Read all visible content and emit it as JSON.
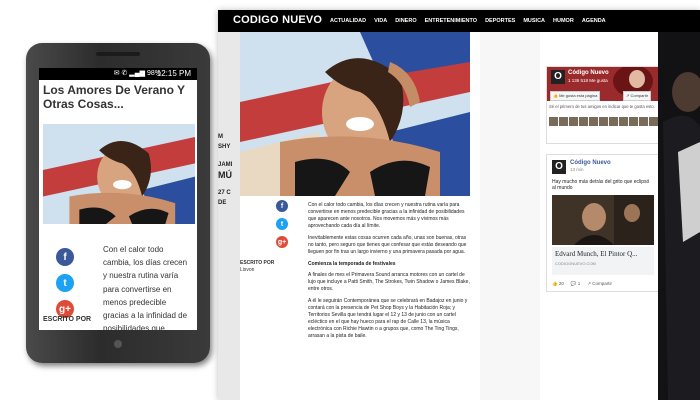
{
  "desktop": {
    "logo": "CODIGO NUEVO",
    "menu": [
      "ACTUALIDAD",
      "VIDA",
      "DINERO",
      "ENTRETENIMIENTO",
      "Deportes",
      "Musica",
      "Humor",
      "Agenda"
    ],
    "left_strip_text": [
      "M",
      "SHY",
      "JAMI",
      "MÚ",
      "27 C",
      "DE"
    ],
    "byline": {
      "label": "ESCRITO POR",
      "author": "Lisvon"
    },
    "body": [
      "Con el calor todo cambia, los días crecen y nuestra rutina varía para convertirse en menos predecible gracias a la infinidad de posibilidades que aparecen ante nosotros. Nos movemos más y vivimos más aprovechando cada día al límite.",
      "Inevitablemente estas cosas ocurren cada año, unas son buenas, otras no tanto, pero seguro que tienes que confesar que estás deseando que lleguen por fin tras un largo invierno y una primavera pasada por agua.",
      "Comienza la temporada de festivales",
      "A finales de mes el Primavera Sound arranca motores con un cartel de lujo que incluye a Patti Smith, The Strokes, Twin Shadow o James Blake, entre otros.",
      "A él le seguirán Contemporánea que se celebrará en Badajoz en junio y contará con la presencia de Pet Shop Boys y la Habitación Roja; y Territorios Sevilla que tendrá lugar el 12 y 13 de junio con un cartel ecléctico en el que hay hueco para el rap de Calle 13, la música electrónica con Richie Hawtin o a grupos que, como The Ting Tings, arrasan a la pista de baile."
    ],
    "fb": {
      "name": "Código Nuevo",
      "likes": "1 136 518 Me gusta",
      "like_button": "Me gusta esta página",
      "share_button": "Compartir",
      "friends_text": "Sé el primero de tus amigos en indicar que te gusta esto."
    },
    "post": {
      "name": "Código Nuevo",
      "time": "13 min",
      "text": "Hay mucho más detrás del grito que eclipsó al mundo",
      "caption_title": "Edvard Munch, El Pintor Q...",
      "caption_url": "CODIGONUEVO.COM",
      "likes": "20",
      "comments": "1",
      "share": "Compartir"
    }
  },
  "phone": {
    "time": "12:15 PM",
    "battery": "98%",
    "title": "Los Amores De Verano Y Otras Cosas...",
    "body": "Con el calor todo cambia, los días crecen y nuestra rutina varía para convertirse en menos predecible gracias a la infinidad de posibilidades que aparecen ante",
    "byline_label": "ESCRITO POR"
  }
}
